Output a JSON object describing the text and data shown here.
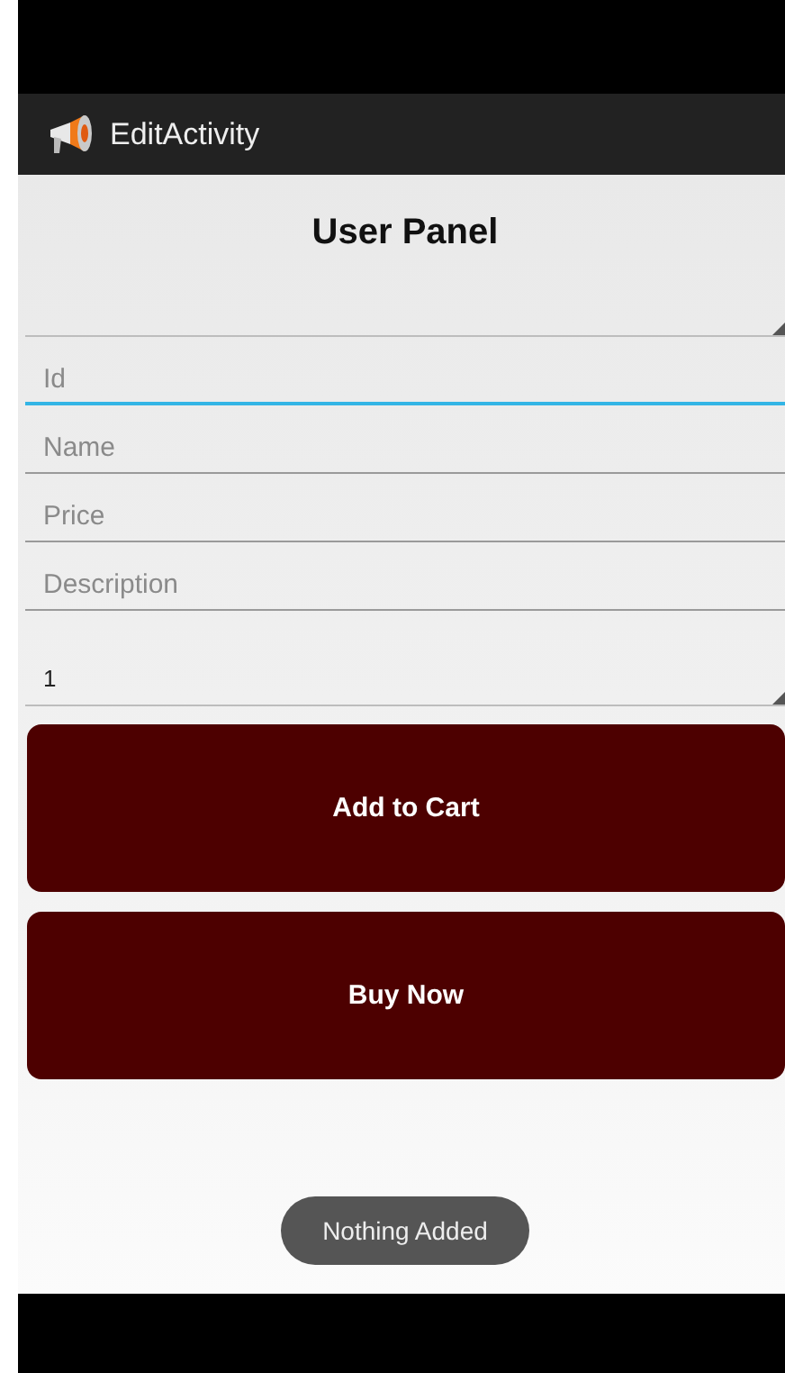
{
  "action_bar": {
    "title": "EditActivity"
  },
  "heading": "User Panel",
  "fields": [
    {
      "placeholder": "Id",
      "focused": true
    },
    {
      "placeholder": "Name",
      "focused": false
    },
    {
      "placeholder": "Price",
      "focused": false
    },
    {
      "placeholder": "Description",
      "focused": false
    }
  ],
  "quantity_spinner": {
    "value": "1"
  },
  "buttons": [
    "Add to Cart",
    "Buy Now"
  ],
  "toast": "Nothing Added"
}
